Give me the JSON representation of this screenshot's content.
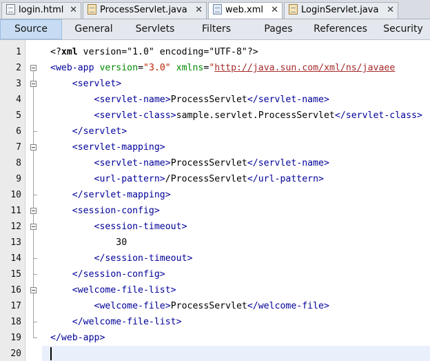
{
  "file_tabs": [
    {
      "label": "login.html",
      "icon": "html-file-icon",
      "active": false
    },
    {
      "label": "ProcessServlet.java",
      "icon": "java-file-icon",
      "active": false
    },
    {
      "label": "web.xml",
      "icon": "xml-file-icon",
      "active": true
    },
    {
      "label": "LoginServlet.java",
      "icon": "java-file-icon",
      "active": false
    }
  ],
  "close_glyph": "✕",
  "view_tabs": [
    {
      "label": "Source",
      "active": true
    },
    {
      "label": "General",
      "active": false
    },
    {
      "label": "Servlets",
      "active": false
    },
    {
      "label": "Filters",
      "active": false
    },
    {
      "label": "Pages",
      "active": false
    },
    {
      "label": "References",
      "active": false
    },
    {
      "label": "Security",
      "active": false
    }
  ],
  "current_line": 20,
  "lines": [
    {
      "n": "1",
      "tokens": [
        [
          "pi",
          "<?"
        ],
        [
          "pib",
          "xml"
        ],
        [
          "pi",
          " version=\"1.0\" encoding=\"UTF-8\"?>"
        ]
      ]
    },
    {
      "n": "2",
      "tokens": [
        [
          "tag",
          "<web-app"
        ],
        [
          "plain",
          " "
        ],
        [
          "attr",
          "version"
        ],
        [
          "plain",
          "="
        ],
        [
          "val",
          "\"3.0\""
        ],
        [
          "plain",
          " "
        ],
        [
          "attr",
          "xmlns"
        ],
        [
          "plain",
          "="
        ],
        [
          "val",
          "\""
        ],
        [
          "url",
          "http://java.sun.com/xml/ns/javaee"
        ]
      ]
    },
    {
      "n": "3",
      "tokens": [
        [
          "plain",
          "    "
        ],
        [
          "tag",
          "<servlet>"
        ]
      ]
    },
    {
      "n": "4",
      "tokens": [
        [
          "plain",
          "        "
        ],
        [
          "tag",
          "<servlet-name>"
        ],
        [
          "plain",
          "ProcessServlet"
        ],
        [
          "tag",
          "</servlet-name>"
        ]
      ]
    },
    {
      "n": "5",
      "tokens": [
        [
          "plain",
          "        "
        ],
        [
          "tag",
          "<servlet-class>"
        ],
        [
          "plain",
          "sample.servlet.ProcessServlet"
        ],
        [
          "tag",
          "</servlet-class>"
        ]
      ]
    },
    {
      "n": "6",
      "tokens": [
        [
          "plain",
          "    "
        ],
        [
          "tag",
          "</servlet>"
        ]
      ]
    },
    {
      "n": "7",
      "tokens": [
        [
          "plain",
          "    "
        ],
        [
          "tag",
          "<servlet-mapping>"
        ]
      ]
    },
    {
      "n": "8",
      "tokens": [
        [
          "plain",
          "        "
        ],
        [
          "tag",
          "<servlet-name>"
        ],
        [
          "plain",
          "ProcessServlet"
        ],
        [
          "tag",
          "</servlet-name>"
        ]
      ]
    },
    {
      "n": "9",
      "tokens": [
        [
          "plain",
          "        "
        ],
        [
          "tag",
          "<url-pattern>"
        ],
        [
          "plain",
          "/ProcessServlet"
        ],
        [
          "tag",
          "</url-pattern>"
        ]
      ]
    },
    {
      "n": "10",
      "tokens": [
        [
          "plain",
          "    "
        ],
        [
          "tag",
          "</servlet-mapping>"
        ]
      ]
    },
    {
      "n": "11",
      "tokens": [
        [
          "plain",
          "    "
        ],
        [
          "tag",
          "<session-config>"
        ]
      ]
    },
    {
      "n": "12",
      "tokens": [
        [
          "plain",
          "        "
        ],
        [
          "tag",
          "<session-timeout>"
        ]
      ]
    },
    {
      "n": "13",
      "tokens": [
        [
          "plain",
          "            30"
        ]
      ]
    },
    {
      "n": "14",
      "tokens": [
        [
          "plain",
          "        "
        ],
        [
          "tag",
          "</session-timeout>"
        ]
      ]
    },
    {
      "n": "15",
      "tokens": [
        [
          "plain",
          "    "
        ],
        [
          "tag",
          "</session-config>"
        ]
      ]
    },
    {
      "n": "16",
      "tokens": [
        [
          "plain",
          "    "
        ],
        [
          "tag",
          "<welcome-file-list>"
        ]
      ]
    },
    {
      "n": "17",
      "tokens": [
        [
          "plain",
          "        "
        ],
        [
          "tag",
          "<welcome-file>"
        ],
        [
          "plain",
          "ProcessServlet"
        ],
        [
          "tag",
          "</welcome-file>"
        ]
      ]
    },
    {
      "n": "18",
      "tokens": [
        [
          "plain",
          "    "
        ],
        [
          "tag",
          "</welcome-file-list>"
        ]
      ]
    },
    {
      "n": "19",
      "tokens": [
        [
          "tag",
          "</web-app>"
        ]
      ]
    },
    {
      "n": "20",
      "tokens": []
    }
  ],
  "folds": [
    {
      "start": 2,
      "end": 19
    },
    {
      "start": 3,
      "end": 6
    },
    {
      "start": 7,
      "end": 10
    },
    {
      "start": 11,
      "end": 15
    },
    {
      "start": 12,
      "end": 14
    },
    {
      "start": 16,
      "end": 18
    }
  ],
  "colors": {
    "tag": "#000099",
    "attribute": "#008800",
    "value": "#bb2200",
    "active_view_tab": "#c7dcf3"
  }
}
